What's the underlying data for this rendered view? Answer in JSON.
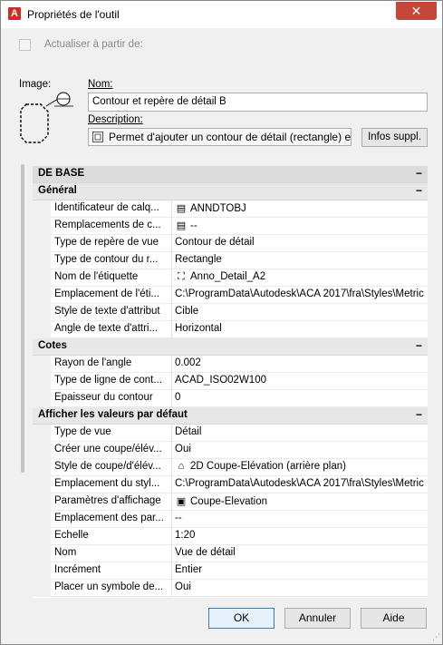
{
  "window": {
    "title": "Propriétés de l'outil",
    "close_label": "✕"
  },
  "top": {
    "checkbox_label": "Actualiser à partir de:",
    "image_label": "Image:",
    "nom_label": "Nom:",
    "nom_value": "Contour et repère de détail B",
    "description_label": "Description:",
    "description_value": "Permet d'ajouter un contour de détail (rectangle) et",
    "infos_button": "Infos suppl."
  },
  "grid": {
    "root_title": "DE BASE",
    "sections": [
      {
        "title": "Général",
        "rows": [
          {
            "name": "Identificateur de calq...",
            "value": "ANNDTOBJ",
            "icon": "layer-icon"
          },
          {
            "name": "Remplacements de c...",
            "value": "--",
            "icon": "layer-icon"
          },
          {
            "name": "Type de repère de vue",
            "value": "Contour de détail",
            "icon": ""
          },
          {
            "name": "Type de contour du r...",
            "value": "Rectangle",
            "icon": ""
          },
          {
            "name": "Nom de l'étiquette",
            "value": "Anno_Detail_A2",
            "icon": "label-icon"
          },
          {
            "name": "Emplacement de l'éti...",
            "value": "C:\\ProgramData\\Autodesk\\ACA 2017\\fra\\Styles\\Metric...",
            "icon": ""
          },
          {
            "name": "Style de texte d'attribut",
            "value": "Cible",
            "icon": ""
          },
          {
            "name": "Angle de texte d'attri...",
            "value": "Horizontal",
            "icon": ""
          }
        ]
      },
      {
        "title": "Cotes",
        "rows": [
          {
            "name": "Rayon de l'angle",
            "value": "0.002",
            "icon": ""
          },
          {
            "name": "Type de ligne de cont...",
            "value": "ACAD_ISO02W100",
            "icon": ""
          },
          {
            "name": "Epaisseur du contour",
            "value": "0",
            "icon": ""
          }
        ]
      },
      {
        "title": "Afficher les valeurs par défaut",
        "rows": [
          {
            "name": "Type de vue",
            "value": "Détail",
            "icon": ""
          },
          {
            "name": "Créer une coupe/élév...",
            "value": "Oui",
            "icon": ""
          },
          {
            "name": "Style de coupe/d'élév...",
            "value": "2D Coupe-Elévation (arrière plan)",
            "icon": "section-icon"
          },
          {
            "name": "Emplacement du styl...",
            "value": "C:\\ProgramData\\Autodesk\\ACA 2017\\fra\\Styles\\Metric...",
            "icon": ""
          },
          {
            "name": "Paramètres d'affichage",
            "value": "Coupe-Elevation",
            "icon": "display-icon"
          },
          {
            "name": "Emplacement des par...",
            "value": "--",
            "icon": ""
          },
          {
            "name": "Echelle",
            "value": "1:20",
            "icon": ""
          },
          {
            "name": "Nom",
            "value": "Vue de détail",
            "icon": ""
          },
          {
            "name": "Incrément",
            "value": "Entier",
            "icon": ""
          },
          {
            "name": "Placer un symbole de...",
            "value": "Oui",
            "icon": ""
          }
        ]
      }
    ]
  },
  "footer": {
    "ok": "OK",
    "annuler": "Annuler",
    "aide": "Aide"
  }
}
